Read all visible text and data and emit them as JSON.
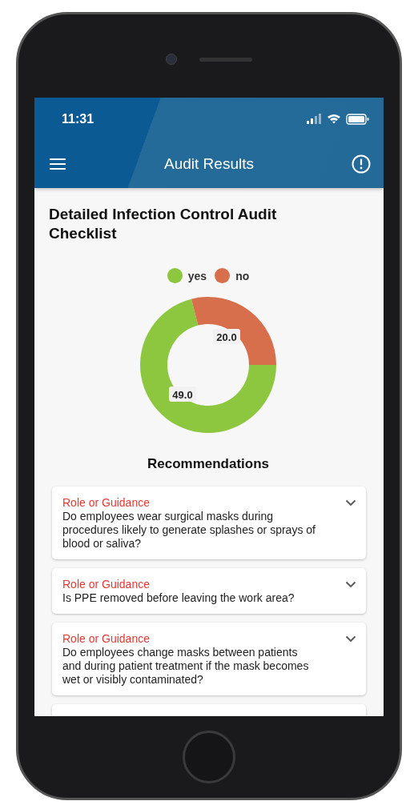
{
  "status_bar": {
    "time": "11:31"
  },
  "app_bar": {
    "title": "Audit Results"
  },
  "page_title": "Detailed Infection Control Audit Checklist",
  "chart_data": {
    "type": "donut",
    "categories": [
      "yes",
      "no"
    ],
    "colors": [
      "#8dc63f",
      "#d86f4c"
    ],
    "values": [
      49.0,
      20.0
    ],
    "value_labels": [
      "49.0",
      "20.0"
    ]
  },
  "recommendations_heading": "Recommendations",
  "recommendations": [
    {
      "label": "Role or Guidance",
      "question": "Do employees wear surgical masks during procedures likely to generate splashes or sprays of blood or saliva?",
      "expanded": false
    },
    {
      "label": "Role or Guidance",
      "question": "Is PPE removed before leaving the work area?",
      "expanded": false
    },
    {
      "label": "Role or Guidance",
      "question": "Do employees change masks between patients and during patient treatment if the mask becomes wet or visibly contaminated?",
      "expanded": false
    }
  ]
}
